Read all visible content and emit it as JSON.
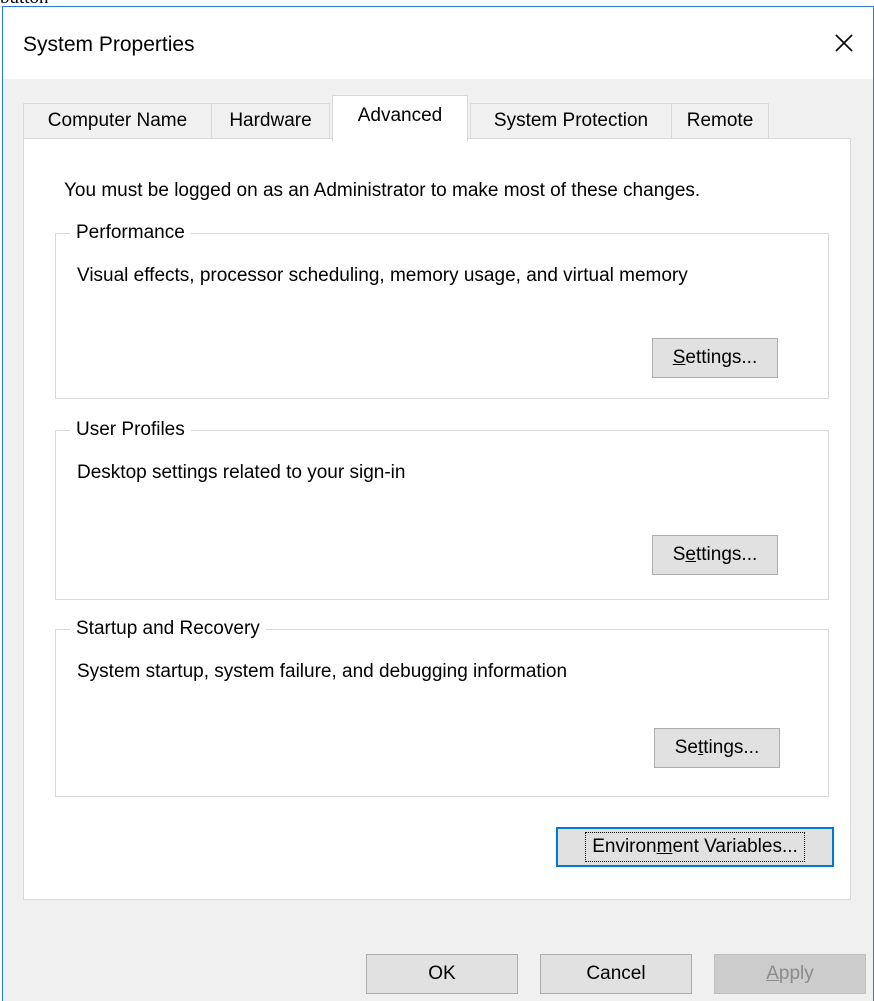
{
  "top_caption": "button",
  "window": {
    "title": "System Properties"
  },
  "tabs": [
    {
      "label": "Computer Name",
      "active": false
    },
    {
      "label": "Hardware",
      "active": false
    },
    {
      "label": "Advanced",
      "active": true
    },
    {
      "label": "System Protection",
      "active": false
    },
    {
      "label": "Remote",
      "active": false
    }
  ],
  "panel": {
    "admin_note": "You must be logged on as an Administrator to make most of these changes.",
    "performance": {
      "label": "Performance",
      "description": "Visual effects, processor scheduling, memory usage, and virtual memory",
      "button": {
        "accel": "S",
        "rest": "ettings..."
      }
    },
    "user_profiles": {
      "label": "User Profiles",
      "description": "Desktop settings related to your sign-in",
      "button": {
        "pre": "S",
        "accel": "e",
        "rest": "ttings..."
      }
    },
    "startup_recovery": {
      "label": "Startup and Recovery",
      "description": "System startup, system failure, and debugging information",
      "button": {
        "pre": "Se",
        "accel": "t",
        "rest": "tings..."
      }
    },
    "env_button": {
      "pre": "Environ",
      "accel": "m",
      "rest": "ent Variables..."
    }
  },
  "footer": {
    "ok": "OK",
    "cancel": "Cancel",
    "apply": {
      "accel": "A",
      "rest": "pply",
      "disabled": true
    }
  },
  "colors": {
    "window_border": "#2b79d8",
    "focus_border": "#0078d7",
    "dialog_bg": "#f0f0f0",
    "button_bg": "#e1e1e1"
  }
}
